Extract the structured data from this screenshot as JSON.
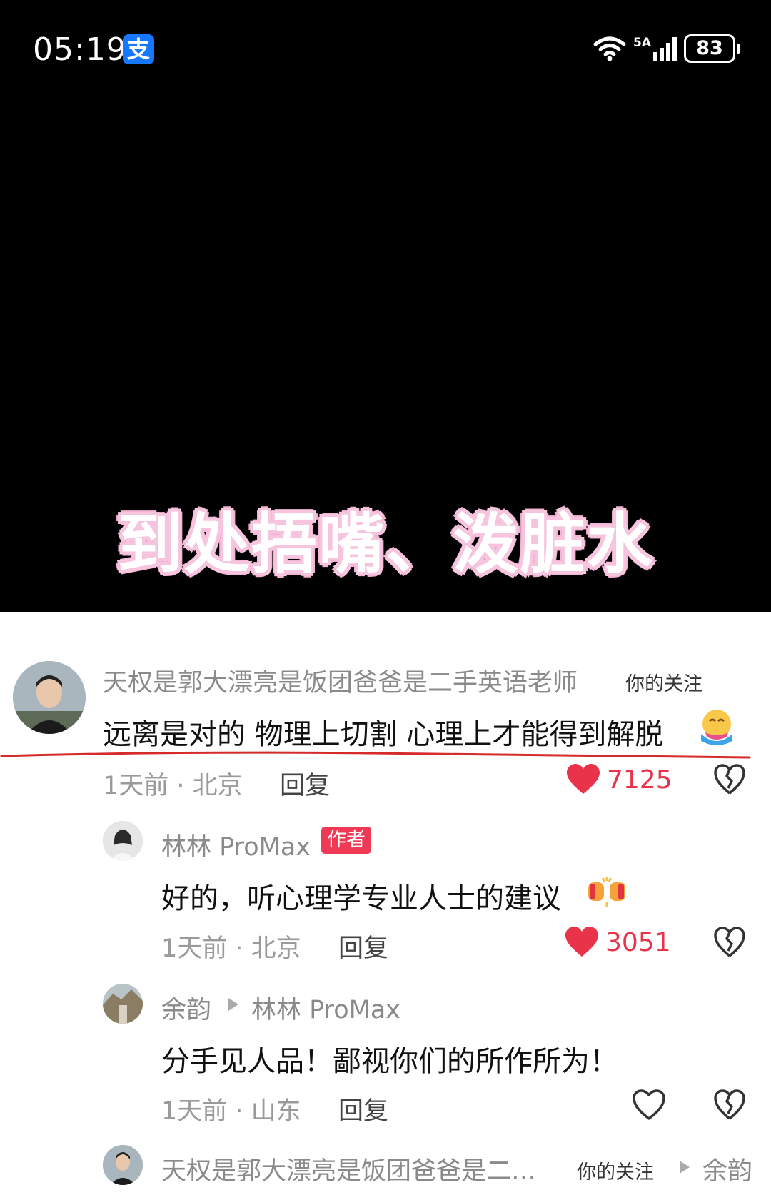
{
  "status_bar": {
    "time": "05:19",
    "alipay_glyph": "支",
    "network": "5A",
    "battery": "83"
  },
  "video": {
    "subtitle": "到处捂嘴、泼脏水"
  },
  "comments": [
    {
      "user": "天权是郭大漂亮是饭团爸爸是二手英语老师",
      "tag": "你的关注",
      "text": "远离是对的 物理上切割 心理上才能得到解脱",
      "emoji": "hug-face-emoji",
      "time_location": "1天前 · 北京",
      "reply_label": "回复",
      "likes": "7125",
      "liked": true
    },
    {
      "user": "林林 ProMax",
      "badge": "作者",
      "text": "好的，听心理学专业人士的建议",
      "emoji": "fist-bump-emoji",
      "time_location": "1天前 · 北京",
      "reply_label": "回复",
      "likes": "3051",
      "liked": true
    },
    {
      "user": "余韵",
      "reply_to": "林林 ProMax",
      "text": "分手见人品！鄙视你们的所作所为！",
      "time_location": "1天前 · 山东",
      "reply_label": "回复",
      "liked": false
    },
    {
      "user": "天权是郭大漂亮是饭团爸爸是二…",
      "tag": "你的关注",
      "reply_to": "余韵"
    }
  ],
  "colors": {
    "like_red": "#e8334a",
    "underline_red": "#d62b2b",
    "author_badge": "#ef3a56"
  }
}
